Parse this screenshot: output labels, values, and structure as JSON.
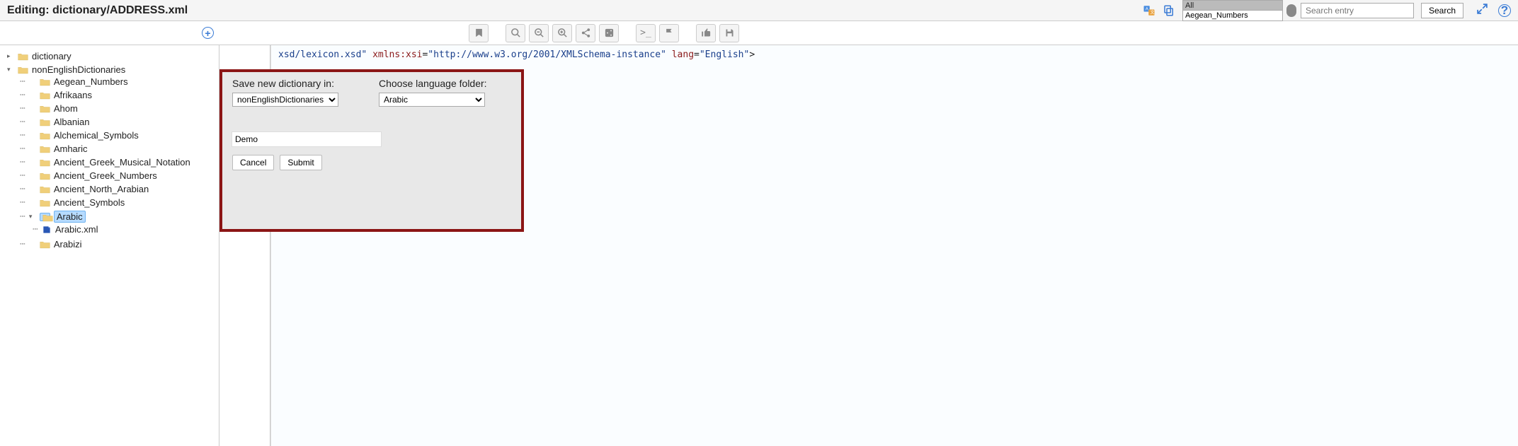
{
  "header": {
    "title": "Editing: dictionary/ADDRESS.xml",
    "filter_all": "All",
    "filter_selected": "Aegean_Numbers",
    "search_placeholder": "Search entry",
    "search_btn": "Search"
  },
  "dialog": {
    "save_label": "Save new dictionary in:",
    "save_value": "nonEnglishDictionaries",
    "lang_label": "Choose language folder:",
    "lang_value": "Arabic",
    "name_value": "Demo",
    "cancel": "Cancel",
    "submit": "Submit"
  },
  "tree": {
    "root1": "dictionary",
    "root2": "nonEnglishDictionaries",
    "children": [
      "Aegean_Numbers",
      "Afrikaans",
      "Ahom",
      "Albanian",
      "Alchemical_Symbols",
      "Amharic",
      "Ancient_Greek_Musical_Notation",
      "Ancient_Greek_Numbers",
      "Ancient_North_Arabian",
      "Ancient_Symbols",
      "Arabic",
      "Arabizi"
    ],
    "arabic_file": "Arabic.xml"
  },
  "editor": {
    "seg1": "xsd/lexicon.xsd\"",
    "attr_xmlns": "xmlns:xsi",
    "val_xmlns": "\"http://www.w3.org/2001/XMLSchema-instance\"",
    "attr_lang": "lang",
    "val_lang": "\"English\"",
    "gt": ">"
  },
  "icons": {
    "translate": "translate-icon",
    "copy": "copy-icon",
    "add": "add-icon",
    "bookmark": "bookmark-icon",
    "zoom": "zoom-icon",
    "zoom_out": "zoom-out-icon",
    "zoom_in": "zoom-in-icon",
    "share": "share-icon",
    "share_alt": "share-alt-icon",
    "terminal": "terminal-icon",
    "flag": "flag-icon",
    "thumbs": "thumbs-up-icon",
    "save": "save-icon",
    "expand": "expand-icon",
    "help": "help-icon"
  }
}
